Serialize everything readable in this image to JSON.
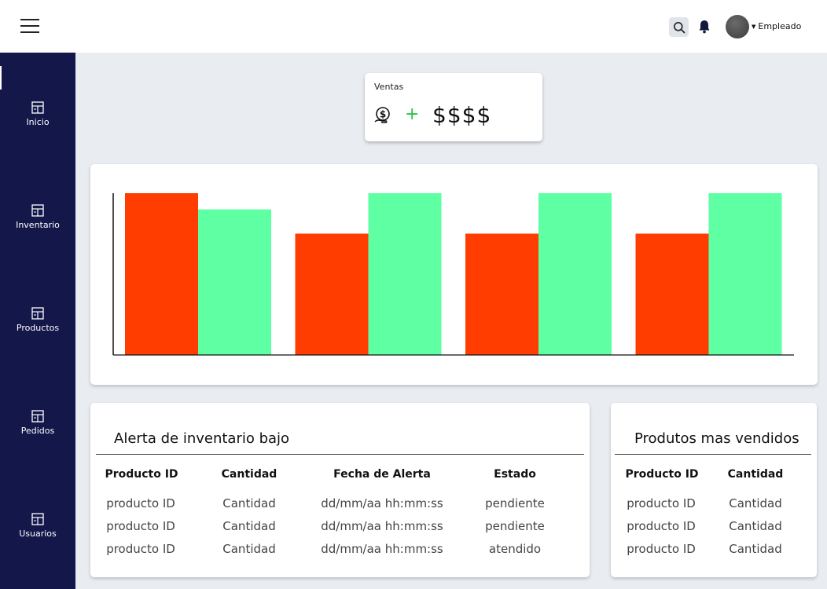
{
  "header": {
    "user_label": "Empleado",
    "icons": [
      "menu-icon",
      "search-icon",
      "bell-icon",
      "avatar"
    ]
  },
  "sidebar": {
    "items": [
      {
        "label": "Inicio",
        "icon": "grid-icon"
      },
      {
        "label": "Inventario",
        "icon": "grid-icon"
      },
      {
        "label": "Productos",
        "icon": "grid-icon"
      },
      {
        "label": "Pedidos",
        "icon": "grid-icon"
      },
      {
        "label": "Usuarios",
        "icon": "grid-icon"
      }
    ],
    "active_index": 0
  },
  "ventas": {
    "title": "Ventas",
    "amount": "$$$$",
    "plus": "+",
    "icon": "money-hand-icon"
  },
  "chart_data": {
    "type": "bar",
    "categories": [
      "",
      "",
      "",
      ""
    ],
    "series": [
      {
        "color": "#ff3d00",
        "values": [
          1.0,
          0.75,
          0.75,
          0.75
        ]
      },
      {
        "color": "#5fffa3",
        "values": [
          0.9,
          1.0,
          1.0,
          1.0
        ]
      }
    ],
    "title": "",
    "xlabel": "",
    "ylabel": "",
    "ylim": [
      0,
      1
    ],
    "grid": false
  },
  "alert_table": {
    "title": "Alerta de inventario bajo",
    "headers": [
      "Producto ID",
      "Cantidad",
      "Fecha de Alerta",
      "Estado"
    ],
    "rows": [
      [
        "producto ID",
        "Cantidad",
        "dd/mm/aa hh:mm:ss",
        "pendiente"
      ],
      [
        "producto ID",
        "Cantidad",
        "dd/mm/aa hh:mm:ss",
        "pendiente"
      ],
      [
        "producto ID",
        "Cantidad",
        "dd/mm/aa hh:mm:ss",
        "atendido"
      ]
    ]
  },
  "top_table": {
    "title": "Produtos mas vendidos",
    "headers": [
      "Producto ID",
      "Cantidad"
    ],
    "rows": [
      [
        "producto ID",
        "Cantidad"
      ],
      [
        "producto ID",
        "Cantidad"
      ],
      [
        "producto ID",
        "Cantidad"
      ]
    ]
  },
  "colors": {
    "sidebar_bg": "#13174a",
    "page_bg": "#e9edf1",
    "bar_a": "#ff3d00",
    "bar_b": "#5fffa3",
    "plus": "#2dbf4a"
  }
}
